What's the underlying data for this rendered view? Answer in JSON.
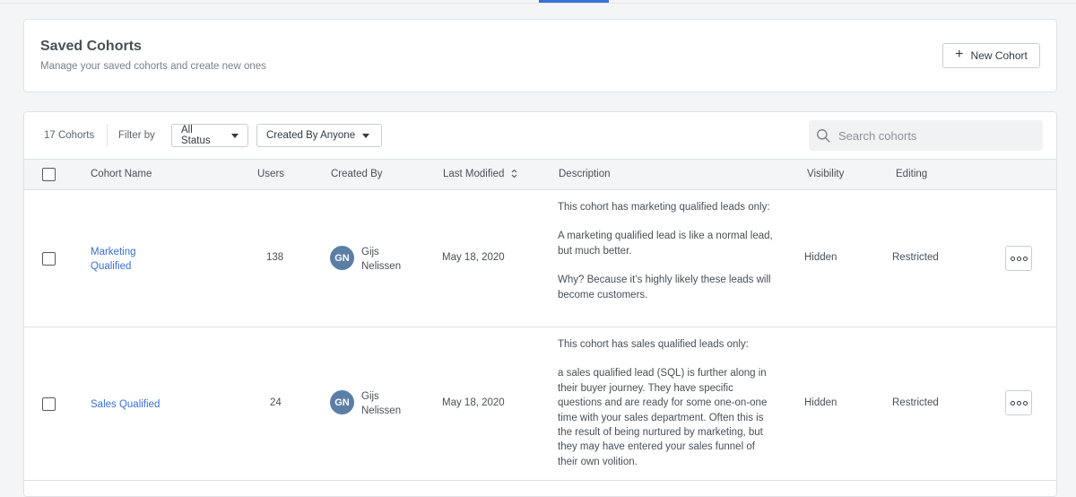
{
  "header": {
    "title": "Saved Cohorts",
    "subtitle": "Manage your saved cohorts and create new ones",
    "new_button": "New Cohort"
  },
  "toolbar": {
    "count": "17 Cohorts",
    "filter_label": "Filter by",
    "status_filter": "All Status",
    "creator_filter": "Created By Anyone",
    "search_placeholder": "Search cohorts"
  },
  "table": {
    "columns": {
      "name": "Cohort Name",
      "users": "Users",
      "created_by": "Created By",
      "last_modified": "Last Modified",
      "description": "Description",
      "visibility": "Visibility",
      "editing": "Editing"
    },
    "rows": [
      {
        "name_line1": "Marketing",
        "name_line2": "Qualified",
        "users": "138",
        "avatar_initials": "GN",
        "creator_first": "Gijs",
        "creator_last": "Nelissen",
        "last_modified": "May 18, 2020",
        "description": [
          "This cohort has marketing qualified leads only:",
          "A marketing qualified lead is like a normal lead, but much better.",
          "Why? Because it’s highly likely these leads will become customers."
        ],
        "visibility": "Hidden",
        "editing": "Restricted"
      },
      {
        "name_line1": "Sales Qualified",
        "name_line2": "",
        "users": "24",
        "avatar_initials": "GN",
        "creator_first": "Gijs",
        "creator_last": "Nelissen",
        "last_modified": "May 18, 2020",
        "description": [
          "This cohort has sales qualified leads only:",
          "a sales qualified lead (SQL) is further along in their buyer journey. They have specific questions and are ready for some one-on-one time with your sales department. Often this is the result of being nurtured by marketing, but they may have entered your sales funnel of their own volition."
        ],
        "visibility": "Hidden",
        "editing": "Restricted"
      }
    ]
  },
  "colors": {
    "link": "#3a6fd8",
    "avatar": "#5a7ea6",
    "header_bg": "#f4f5f7"
  }
}
